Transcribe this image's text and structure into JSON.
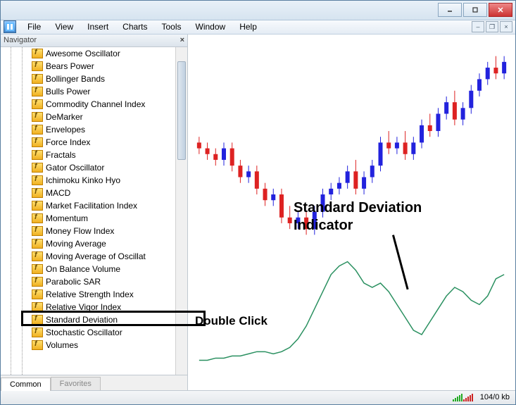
{
  "menubar": {
    "items": [
      "File",
      "View",
      "Insert",
      "Charts",
      "Tools",
      "Window",
      "Help"
    ]
  },
  "navigator": {
    "title": "Navigator",
    "indicators": [
      "Awesome Oscillator",
      "Bears Power",
      "Bollinger Bands",
      "Bulls Power",
      "Commodity Channel Index",
      "DeMarker",
      "Envelopes",
      "Force Index",
      "Fractals",
      "Gator Oscillator",
      "Ichimoku Kinko Hyo",
      "MACD",
      "Market Facilitation Index",
      "Momentum",
      "Money Flow Index",
      "Moving Average",
      "Moving Average of Oscillat",
      "On Balance Volume",
      "Parabolic SAR",
      "Relative Strength Index",
      "Relative Vigor Index",
      "Standard Deviation",
      "Stochastic Oscillator",
      "Volumes"
    ],
    "tabs": {
      "common": "Common",
      "favorites": "Favorites"
    }
  },
  "chart_data": {
    "type": "candlestick",
    "timeframe_implied": true,
    "series": [
      {
        "o": 58,
        "h": 60,
        "l": 54,
        "c": 56,
        "color": "red"
      },
      {
        "o": 56,
        "h": 58,
        "l": 52,
        "c": 54,
        "color": "red"
      },
      {
        "o": 54,
        "h": 56,
        "l": 50,
        "c": 52,
        "color": "red"
      },
      {
        "o": 52,
        "h": 58,
        "l": 50,
        "c": 56,
        "color": "blue"
      },
      {
        "o": 56,
        "h": 58,
        "l": 48,
        "c": 50,
        "color": "red"
      },
      {
        "o": 50,
        "h": 52,
        "l": 44,
        "c": 46,
        "color": "red"
      },
      {
        "o": 46,
        "h": 50,
        "l": 44,
        "c": 48,
        "color": "blue"
      },
      {
        "o": 48,
        "h": 50,
        "l": 40,
        "c": 42,
        "color": "red"
      },
      {
        "o": 42,
        "h": 44,
        "l": 36,
        "c": 38,
        "color": "red"
      },
      {
        "o": 38,
        "h": 42,
        "l": 36,
        "c": 40,
        "color": "blue"
      },
      {
        "o": 40,
        "h": 42,
        "l": 30,
        "c": 32,
        "color": "red"
      },
      {
        "o": 32,
        "h": 36,
        "l": 28,
        "c": 30,
        "color": "red"
      },
      {
        "o": 30,
        "h": 34,
        "l": 28,
        "c": 32,
        "color": "blue"
      },
      {
        "o": 32,
        "h": 34,
        "l": 26,
        "c": 28,
        "color": "red"
      },
      {
        "o": 28,
        "h": 36,
        "l": 26,
        "c": 34,
        "color": "blue"
      },
      {
        "o": 34,
        "h": 42,
        "l": 32,
        "c": 40,
        "color": "blue"
      },
      {
        "o": 40,
        "h": 44,
        "l": 38,
        "c": 42,
        "color": "blue"
      },
      {
        "o": 42,
        "h": 46,
        "l": 40,
        "c": 44,
        "color": "blue"
      },
      {
        "o": 44,
        "h": 50,
        "l": 42,
        "c": 48,
        "color": "blue"
      },
      {
        "o": 48,
        "h": 52,
        "l": 40,
        "c": 42,
        "color": "red"
      },
      {
        "o": 42,
        "h": 48,
        "l": 40,
        "c": 46,
        "color": "blue"
      },
      {
        "o": 46,
        "h": 52,
        "l": 44,
        "c": 50,
        "color": "blue"
      },
      {
        "o": 50,
        "h": 60,
        "l": 48,
        "c": 58,
        "color": "blue"
      },
      {
        "o": 58,
        "h": 62,
        "l": 54,
        "c": 56,
        "color": "red"
      },
      {
        "o": 56,
        "h": 60,
        "l": 54,
        "c": 58,
        "color": "blue"
      },
      {
        "o": 58,
        "h": 62,
        "l": 52,
        "c": 54,
        "color": "red"
      },
      {
        "o": 54,
        "h": 60,
        "l": 52,
        "c": 58,
        "color": "blue"
      },
      {
        "o": 58,
        "h": 66,
        "l": 56,
        "c": 64,
        "color": "blue"
      },
      {
        "o": 64,
        "h": 68,
        "l": 60,
        "c": 62,
        "color": "red"
      },
      {
        "o": 62,
        "h": 70,
        "l": 60,
        "c": 68,
        "color": "blue"
      },
      {
        "o": 68,
        "h": 74,
        "l": 66,
        "c": 72,
        "color": "blue"
      },
      {
        "o": 72,
        "h": 76,
        "l": 64,
        "c": 66,
        "color": "red"
      },
      {
        "o": 66,
        "h": 72,
        "l": 64,
        "c": 70,
        "color": "blue"
      },
      {
        "o": 70,
        "h": 78,
        "l": 68,
        "c": 76,
        "color": "blue"
      },
      {
        "o": 76,
        "h": 82,
        "l": 74,
        "c": 80,
        "color": "blue"
      },
      {
        "o": 80,
        "h": 86,
        "l": 78,
        "c": 84,
        "color": "blue"
      },
      {
        "o": 84,
        "h": 88,
        "l": 80,
        "c": 82,
        "color": "red"
      },
      {
        "o": 82,
        "h": 88,
        "l": 80,
        "c": 86,
        "color": "blue"
      }
    ],
    "indicator_line": {
      "name": "Standard Deviation",
      "color": "#2a9060",
      "points": [
        10,
        10,
        11,
        11,
        12,
        12,
        13,
        14,
        14,
        13,
        14,
        16,
        20,
        26,
        34,
        42,
        50,
        54,
        56,
        52,
        46,
        44,
        46,
        42,
        36,
        30,
        24,
        22,
        28,
        34,
        40,
        44,
        42,
        38,
        36,
        40,
        48,
        50
      ]
    }
  },
  "annotations": {
    "label_main_1": "Standard Deviation",
    "label_main_2": "Indicator",
    "label_dbl": "Double Click"
  },
  "statusbar": {
    "transfer": "104/0 kb"
  }
}
